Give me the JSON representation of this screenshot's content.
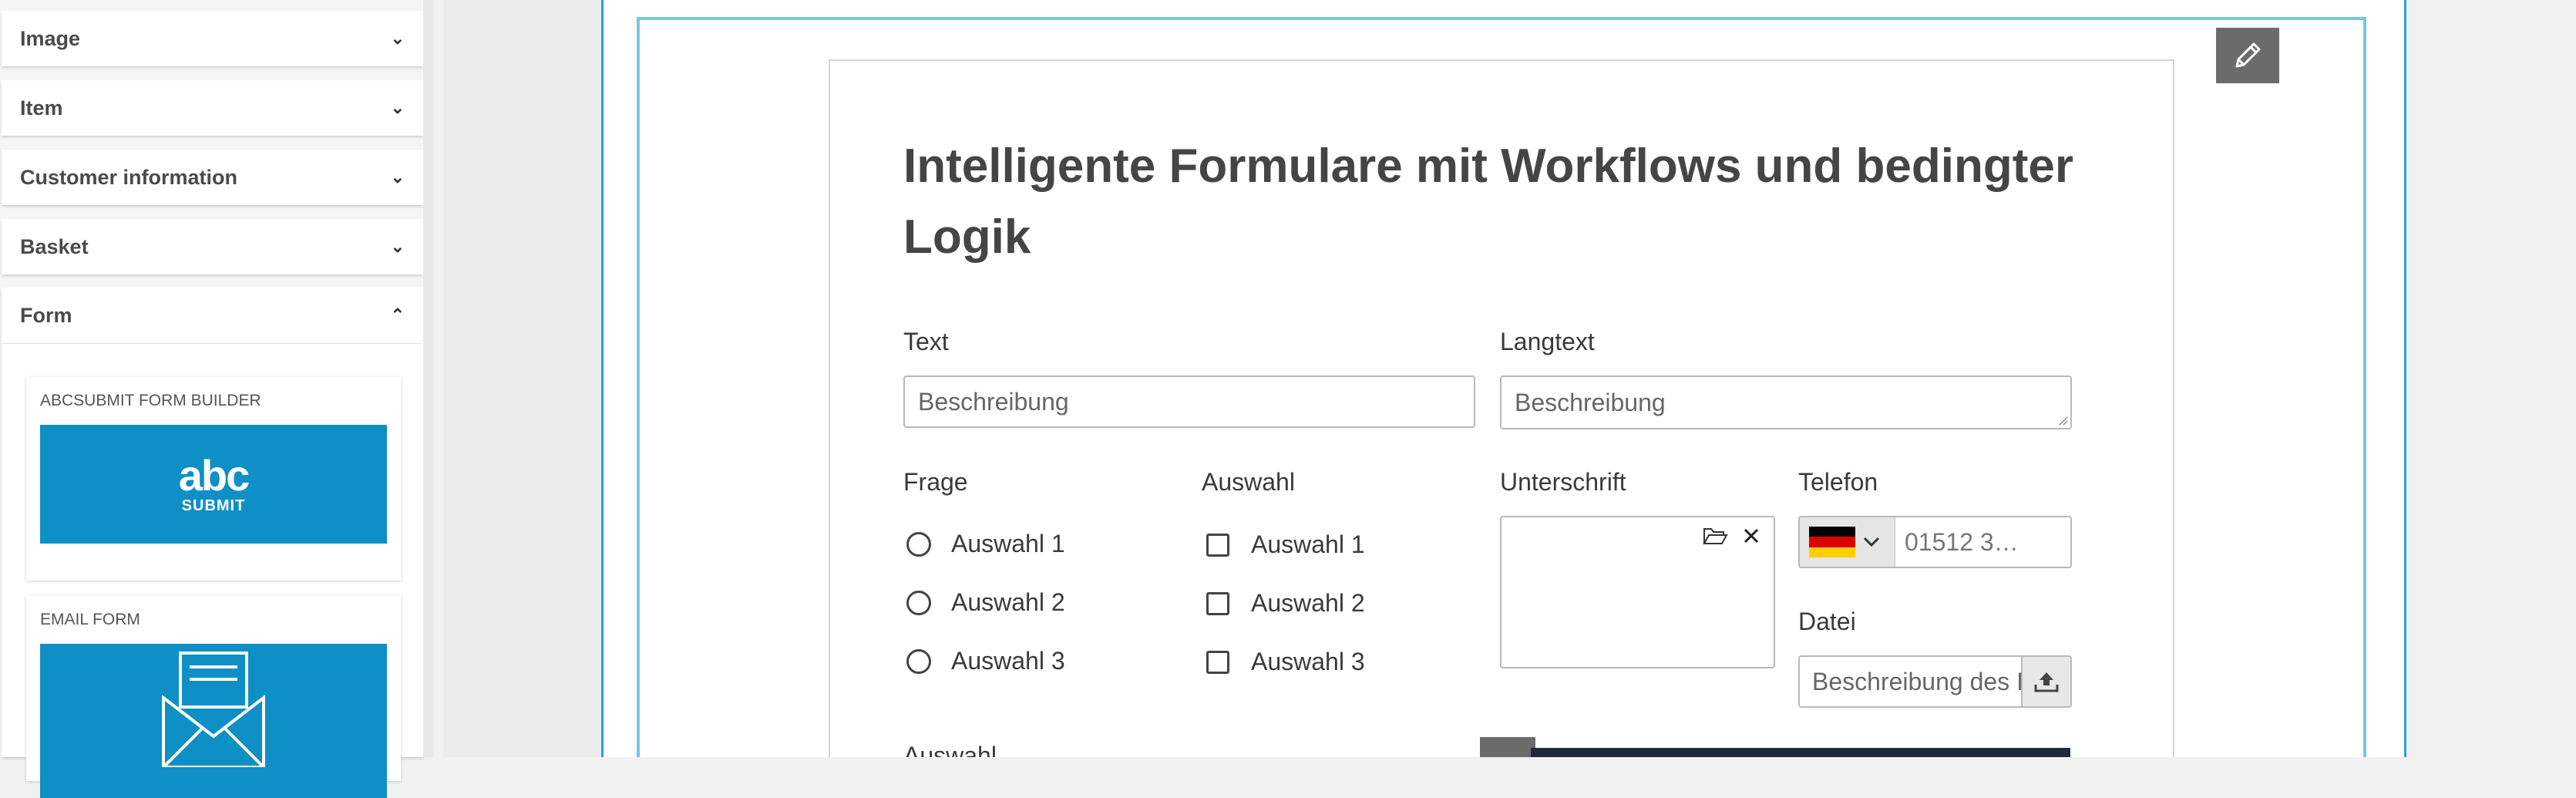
{
  "sidebar": {
    "items": [
      {
        "label": "Image",
        "icon": "chevron-down-icon"
      },
      {
        "label": "Item",
        "icon": "chevron-down-icon"
      },
      {
        "label": "Customer information",
        "icon": "chevron-down-icon"
      },
      {
        "label": "Basket",
        "icon": "chevron-down-icon"
      }
    ],
    "form_section": {
      "label": "Form",
      "icon": "chevron-up-icon",
      "cards": [
        {
          "title": "ABCSUBMIT FORM BUILDER",
          "logo_text": "abc",
          "logo_sub": "SUBMIT"
        },
        {
          "title": "EMAIL FORM"
        }
      ]
    }
  },
  "form": {
    "title": "Intelligente Formulare mit Workflows und bedingter Logik",
    "text_label": "Text",
    "text_placeholder": "Beschreibung",
    "langtext_label": "Langtext",
    "langtext_placeholder": "Beschreibung",
    "frage_label": "Frage",
    "frage_options": [
      "Auswahl 1",
      "Auswahl 2",
      "Auswahl 3"
    ],
    "auswahl_label": "Auswahl",
    "auswahl_options": [
      "Auswahl 1",
      "Auswahl 2",
      "Auswahl 3"
    ],
    "unterschrift_label": "Unterschrift",
    "telefon_label": "Telefon",
    "telefon_placeholder": "01512 3…",
    "datei_label": "Datei",
    "datei_placeholder": "Beschreibung des I",
    "cut_label": "Auswahl"
  },
  "colors": {
    "accent": "#2aa3d6",
    "card_blue": "#0e8fc6",
    "edit_button": "#6b6b6b"
  }
}
